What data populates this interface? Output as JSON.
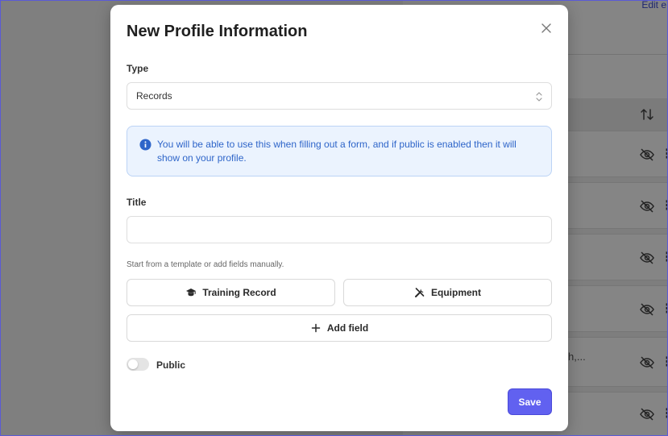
{
  "modal": {
    "title": "New Profile Information",
    "type_label": "Type",
    "type_value": "Records",
    "info_text": "You will be able to use this when filling out a form, and if public is enabled then it will show on your profile.",
    "title_label": "Title",
    "title_value": "",
    "title_placeholder": "",
    "hint_text": "Start from a template or add fields manually.",
    "template_buttons": [
      {
        "label": "Training Record",
        "icon": "graduation-cap-icon"
      },
      {
        "label": "Equipment",
        "icon": "tools-icon"
      }
    ],
    "add_field_label": "Add field",
    "public_label": "Public",
    "public_enabled": false,
    "save_label": "Save"
  },
  "background": {
    "edit_link_fragment": "Edit e",
    "row_text_fragment": "h,..."
  },
  "colors": {
    "accent": "#6161f0",
    "info_bg": "#ebf3fe",
    "info_text": "#2e65c9"
  }
}
